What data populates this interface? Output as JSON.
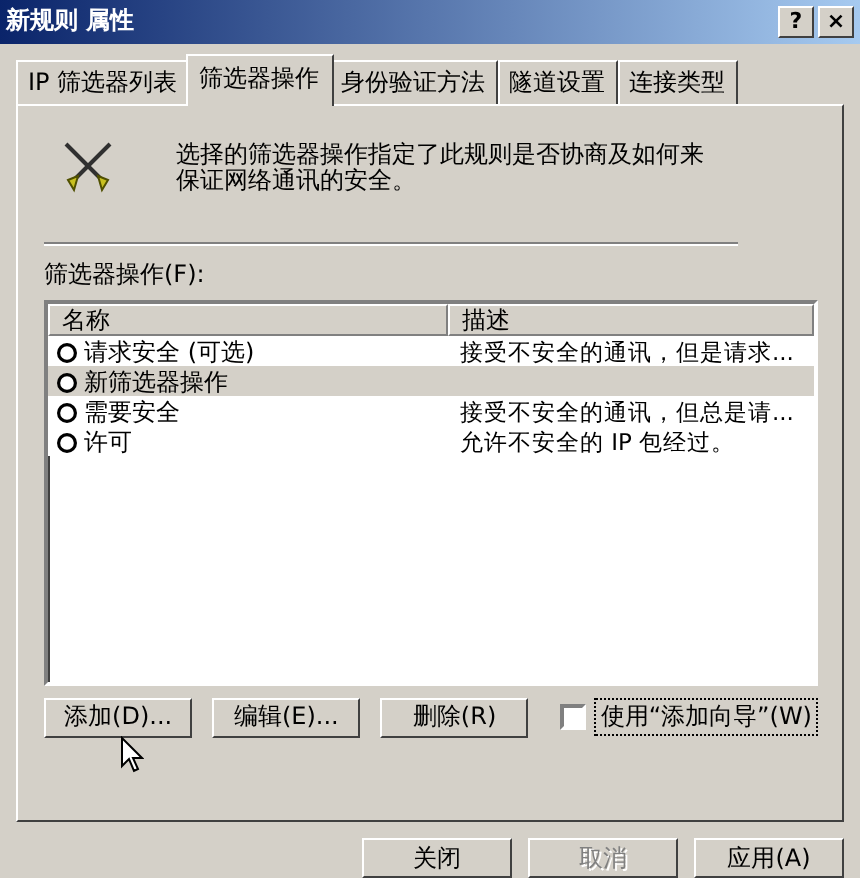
{
  "window": {
    "title": "新规则 属性"
  },
  "title_buttons": [
    "?",
    "×"
  ],
  "tabs": [
    {
      "label": "IP 筛选器列表",
      "selected": false
    },
    {
      "label": "筛选器操作",
      "selected": true
    },
    {
      "label": "身份验证方法",
      "selected": false
    },
    {
      "label": "隧道设置",
      "selected": false
    },
    {
      "label": "连接类型",
      "selected": false
    }
  ],
  "intro": "选择的筛选器操作指定了此规则是否协商及如何来保证网络通讯的安全。",
  "list_label": "筛选器操作(F):",
  "table": {
    "columns": [
      "名称",
      "描述"
    ],
    "rows": [
      {
        "name": "请求安全 (可选)",
        "description": "接受不安全的通讯，但是请求...",
        "selected": false
      },
      {
        "name": "新筛选器操作",
        "description": "",
        "selected": true
      },
      {
        "name": "需要安全",
        "description": "接受不安全的通讯，但总是请...",
        "selected": false
      },
      {
        "name": "许可",
        "description": "允许不安全的 IP 包经过。",
        "selected": false
      }
    ]
  },
  "actions": [
    "添加(D)...",
    "编辑(E)...",
    "删除(R)"
  ],
  "wizard": {
    "label": "使用“添加向导”(W)",
    "checked": false
  },
  "footer_buttons": [
    {
      "label": "关闭",
      "disabled": false
    },
    {
      "label": "取消",
      "disabled": true
    },
    {
      "label": "应用(A)",
      "disabled": false
    }
  ]
}
